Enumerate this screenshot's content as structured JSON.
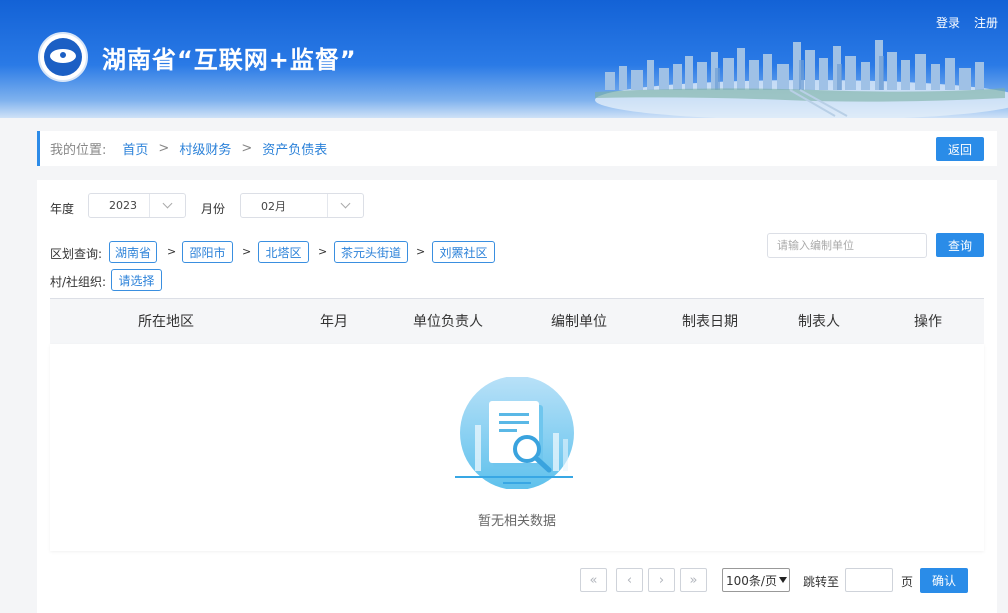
{
  "header": {
    "title": "湖南省“互联网+监督”",
    "login": "登录",
    "register": "注册",
    "logo_icon": "eye-logo-icon",
    "brand_color": "#1362d6"
  },
  "breadcrumb": {
    "prefix": "我的位置:",
    "items": [
      "首页",
      "村级财务",
      "资产负债表"
    ],
    "separator": ">",
    "back": "返回"
  },
  "filters": {
    "year_label": "年度",
    "year_value": "2023",
    "month_label": "月份",
    "month_value": "02月",
    "region_label": "区划查询:",
    "regions": [
      "湖南省",
      "邵阳市",
      "北塔区",
      "茶元头街道",
      "刘罴社区"
    ],
    "org_label": "村/社组织:",
    "org_select": "请选择",
    "search_placeholder": "请输入编制单位",
    "search_button": "查询"
  },
  "table": {
    "columns": [
      "所在地区",
      "年月",
      "单位负责人",
      "编制单位",
      "制表日期",
      "制表人",
      "操作"
    ],
    "rows": [],
    "empty_text": "暂无相关数据"
  },
  "pagination": {
    "first": "«",
    "prev": "‹",
    "next": "›",
    "last": "»",
    "page_size": "100条/页",
    "jump_label": "跳转至",
    "page_unit": "页",
    "confirm": "确认"
  },
  "colors": {
    "accent": "#2a8ce8",
    "link": "#2c82d9"
  }
}
